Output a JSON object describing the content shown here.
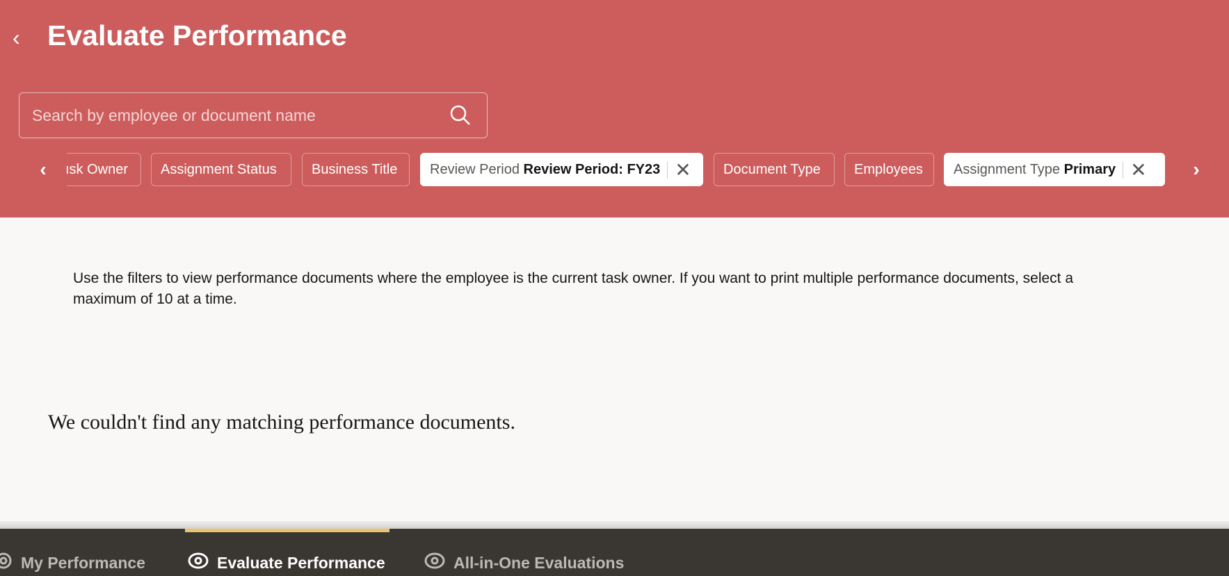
{
  "header": {
    "title": "Evaluate Performance"
  },
  "search": {
    "placeholder": "Search by employee or document name"
  },
  "filters": [
    {
      "label": "Task Owner",
      "display": "ısk Owner"
    },
    {
      "label": "Assignment Status"
    },
    {
      "label": "Business Title"
    },
    {
      "label": "Review Period",
      "value": "Review Period: FY23"
    },
    {
      "label": "Document Type"
    },
    {
      "label": "Employees"
    },
    {
      "label": "Assignment Type",
      "value": "Primary"
    }
  ],
  "main": {
    "instructions": "Use the filters to view performance documents where the employee is the current task owner. If you want to print multiple performance documents, select a maximum of 10 at a time.",
    "empty_message": "We couldn't find any matching performance documents."
  },
  "nav": {
    "tabs": [
      {
        "label": "My Performance"
      },
      {
        "label": "Evaluate Performance"
      },
      {
        "label": "All-in-One Evaluations"
      }
    ]
  },
  "colors": {
    "header": "#cd5c5c",
    "nav": "#3a3631",
    "indicator": "#e8c46a"
  }
}
